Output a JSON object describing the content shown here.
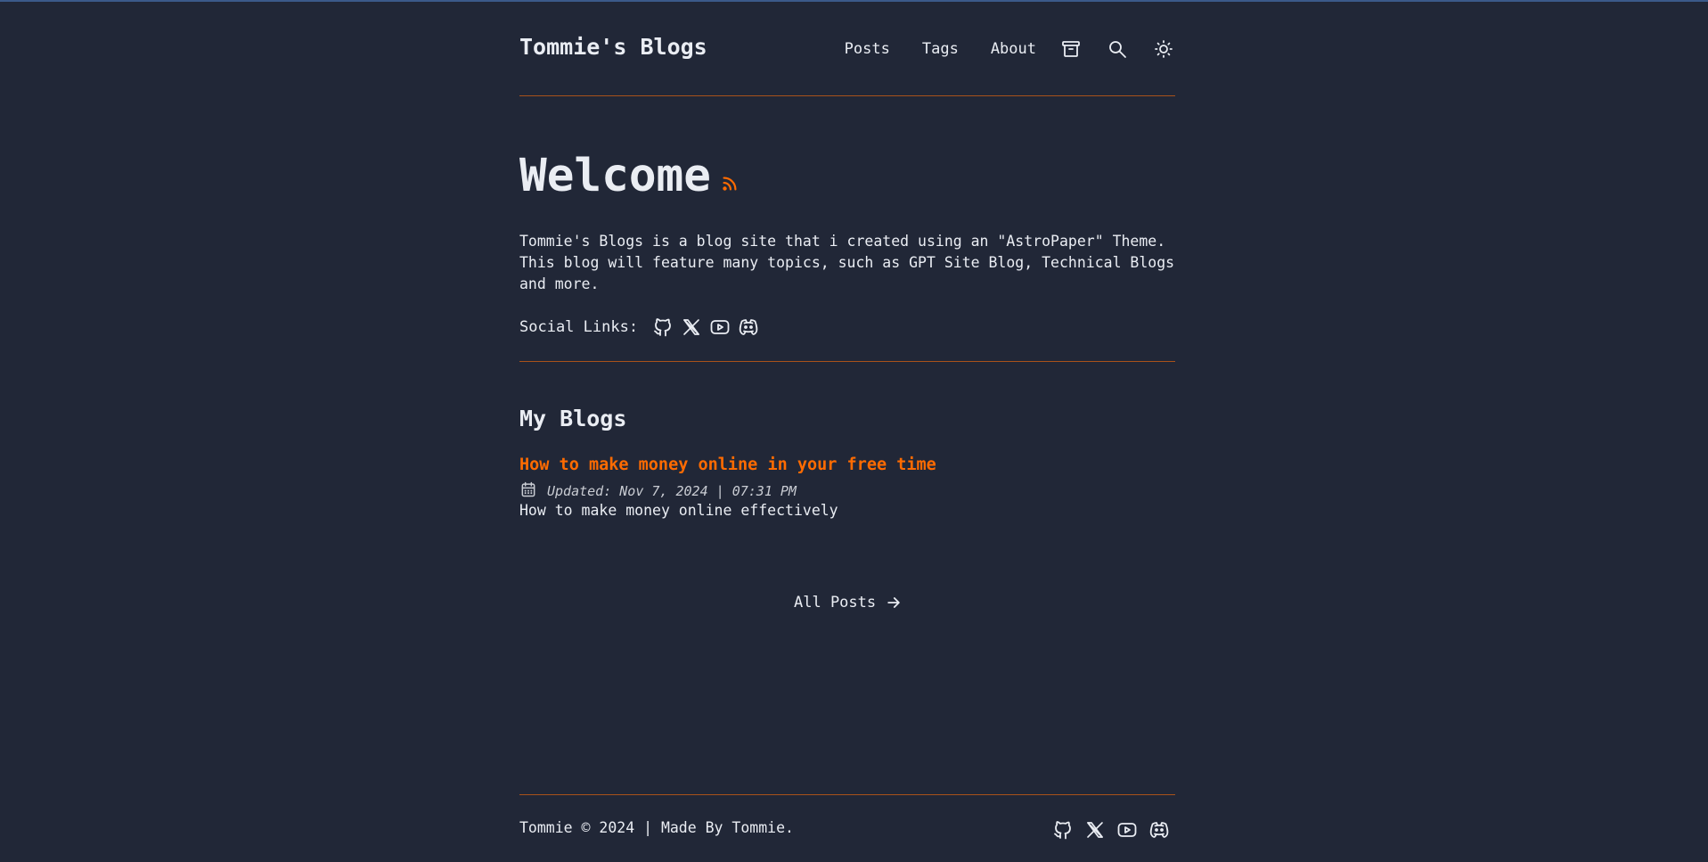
{
  "site": {
    "title": "Tommie's Blogs"
  },
  "nav": {
    "items": [
      {
        "label": "Posts"
      },
      {
        "label": "Tags"
      },
      {
        "label": "About"
      }
    ],
    "icons": [
      "archive-icon",
      "search-icon",
      "theme-toggle-sun-icon"
    ]
  },
  "hero": {
    "title": "Welcome",
    "rss_icon": "rss-icon",
    "intro": "Tommie's Blogs is a blog site that i created using an \"AstroPaper\" Theme. This blog will feature many topics, such as GPT Site Blog, Technical Blogs and more.",
    "social_label": "Social Links:",
    "social_icons": [
      "github-icon",
      "x-icon",
      "youtube-icon",
      "discord-icon"
    ]
  },
  "blogs": {
    "heading": "My Blogs",
    "posts": [
      {
        "title": "How to make money online in your free time",
        "date": "Updated: Nov 7, 2024 | 07:31 PM",
        "description": "How to make money online effectively"
      }
    ],
    "all_posts_label": "All Posts"
  },
  "footer": {
    "text": "Tommie © 2024 | Made By Tommie.",
    "social_icons": [
      "github-icon",
      "x-icon",
      "youtube-icon",
      "discord-icon"
    ]
  },
  "colors": {
    "background": "#212737",
    "text": "#eaedf3",
    "accent": "#ff6b01",
    "divider": "#a8521a"
  }
}
